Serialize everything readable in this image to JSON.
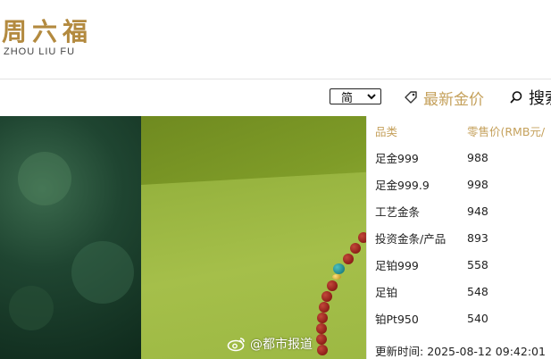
{
  "brand": {
    "name_cn": "周六福",
    "name_en": "ZHOU LIU FU",
    "color": "#b38a3f"
  },
  "toolbar": {
    "language_selected": "简",
    "latest_price_label": "最新金价",
    "search_label": "搜索",
    "accent_color": "#c5a15c"
  },
  "price_panel": {
    "header": {
      "category": "品类",
      "retail_price": "零售价(RMB元/"
    },
    "rows": [
      {
        "category": "足金999",
        "price": "988"
      },
      {
        "category": "足金999.9",
        "price": "998"
      },
      {
        "category": "工艺金条",
        "price": "948"
      },
      {
        "category": "投资金条/产品",
        "price": "893"
      },
      {
        "category": "足铂999",
        "price": "558"
      },
      {
        "category": "足铂",
        "price": "548"
      },
      {
        "category": "铂Pt950",
        "price": "540"
      }
    ],
    "updated_label": "更新时间: ",
    "updated_time": "2025-08-12 09:42:01"
  },
  "watermark": {
    "icon": "weibo-icon",
    "text": "@都市报道"
  }
}
